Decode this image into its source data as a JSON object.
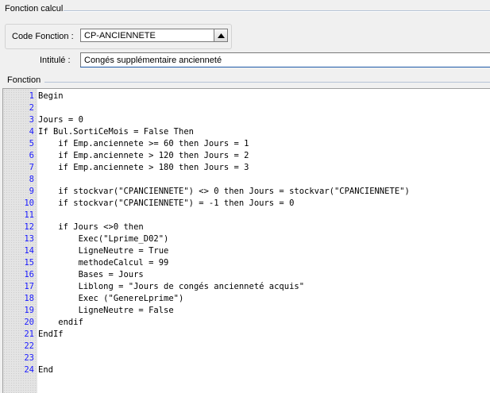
{
  "section_top": {
    "title": "Fonction calcul"
  },
  "code_fonction": {
    "label": "Code Fonction :",
    "value": "CP-ANCIENNETE",
    "button_icon": "triangle-up-icon"
  },
  "intitule": {
    "label": "Intitulé :",
    "value": "Congés supplémentaire ancienneté"
  },
  "section_fonction": {
    "title": "Fonction"
  },
  "editor": {
    "lines": [
      {
        "n": "1",
        "code": "Begin"
      },
      {
        "n": "2",
        "code": ""
      },
      {
        "n": "3",
        "code": "Jours = 0"
      },
      {
        "n": "4",
        "code": "If Bul.SortiCeMois = False Then"
      },
      {
        "n": "5",
        "code": "    if Emp.anciennete >= 60 then Jours = 1"
      },
      {
        "n": "6",
        "code": "    if Emp.anciennete > 120 then Jours = 2"
      },
      {
        "n": "7",
        "code": "    if Emp.anciennete > 180 then Jours = 3"
      },
      {
        "n": "8",
        "code": ""
      },
      {
        "n": "9",
        "code": "    if stockvar(\"CPANCIENNETE\") <> 0 then Jours = stockvar(\"CPANCIENNETE\")"
      },
      {
        "n": "10",
        "code": "    if stockvar(\"CPANCIENNETE\") = -1 then Jours = 0"
      },
      {
        "n": "11",
        "code": ""
      },
      {
        "n": "12",
        "code": "    if Jours <>0 then"
      },
      {
        "n": "13",
        "code": "        Exec(\"Lprime_D02\")"
      },
      {
        "n": "14",
        "code": "        LigneNeutre = True"
      },
      {
        "n": "15",
        "code": "        methodeCalcul = 99"
      },
      {
        "n": "16",
        "code": "        Bases = Jours"
      },
      {
        "n": "17",
        "code": "        Liblong = \"Jours de congés ancienneté acquis\""
      },
      {
        "n": "18",
        "code": "        Exec (\"GenereLprime\")"
      },
      {
        "n": "19",
        "code": "        LigneNeutre = False"
      },
      {
        "n": "20",
        "code": "    endif"
      },
      {
        "n": "21",
        "code": "EndIf"
      },
      {
        "n": "22",
        "code": ""
      },
      {
        "n": "23",
        "code": ""
      },
      {
        "n": "24",
        "code": "End"
      }
    ]
  }
}
